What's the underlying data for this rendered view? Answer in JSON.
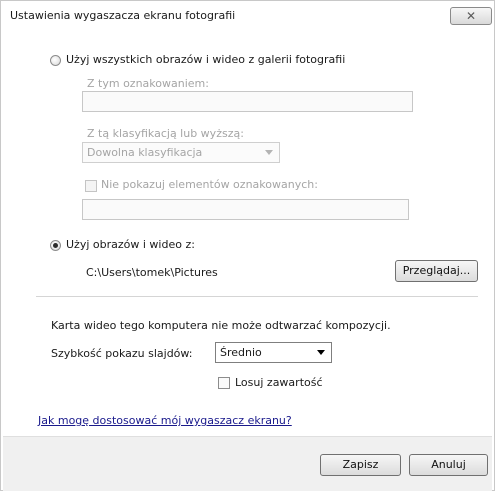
{
  "window": {
    "title": "Ustawienia wygaszacza ekranu fotografii",
    "close_glyph": "✕"
  },
  "gallery_option": {
    "label": "Użyj wszystkich obrazów i wideo z galerii fotografii",
    "selected": false,
    "tag_label": "Z tym oznakowaniem:",
    "tag_value": "",
    "rating_label": "Z tą klasyfikacją lub wyższą:",
    "rating_value": "Dowolna klasyfikacja",
    "exclude_label": "Nie pokazuj elementów oznakowanych:",
    "exclude_value": ""
  },
  "folder_option": {
    "label": "Użyj obrazów i wideo z:",
    "selected": true,
    "path": "C:\\Users\\tomek\\Pictures",
    "browse_label": "Przeglądaj..."
  },
  "settings": {
    "video_warning": "Karta wideo tego komputera nie może odtwarzać kompozycji.",
    "speed_label": "Szybkość pokazu slajdów:",
    "speed_value": "Średnio",
    "shuffle_label": "Losuj zawartość",
    "shuffle_checked": false
  },
  "help_link": "Jak mogę dostosować mój wygaszacz ekranu?",
  "footer": {
    "save_label": "Zapisz",
    "cancel_label": "Anuluj"
  },
  "colors": {
    "disabled_text": "#a5a5a5",
    "link": "#1a1a8c",
    "footer_bg": "#f0f0f0"
  }
}
